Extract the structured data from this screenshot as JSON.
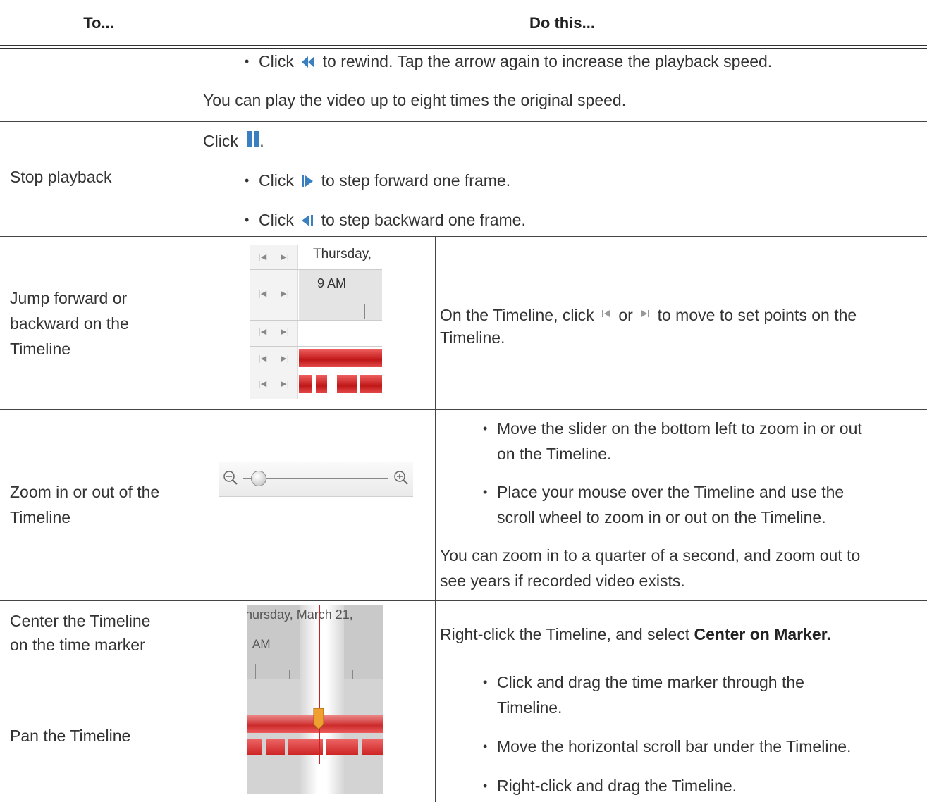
{
  "header": {
    "col1": "To...",
    "col2": "Do this..."
  },
  "rows": {
    "rewind": {
      "bullet": {
        "pre": "Click",
        "post": "to rewind. Tap the arrow again to increase the playback speed."
      },
      "note": "You can play the video up to eight times the original speed."
    },
    "stop": {
      "label": "Stop playback",
      "click": "Click",
      "period": ".",
      "bullets": [
        {
          "pre": "Click",
          "post": "to step forward one frame."
        },
        {
          "pre": "Click",
          "post": "to step backward one frame."
        }
      ]
    },
    "jump": {
      "label": [
        "Jump forward or",
        "backward on the",
        "Timeline"
      ],
      "image": {
        "day": "Thursday,",
        "time": "9 AM"
      },
      "text": {
        "pre": "On the Timeline, click",
        "mid": "or",
        "post": "to move to set points on the",
        "line2": "Timeline."
      }
    },
    "zoom": {
      "label": [
        "Zoom in or out of the",
        "Timeline"
      ],
      "bullets": [
        [
          "Move the slider on the bottom left to zoom in or out",
          "on the Timeline."
        ],
        [
          "Place your mouse over the Timeline and use the",
          "scroll wheel to zoom in or out on the Timeline."
        ]
      ],
      "note": [
        "You can zoom in to a quarter of a second, and zoom out to",
        "see years if recorded video exists."
      ]
    },
    "center": {
      "label": [
        "Center the Timeline",
        "on the time marker"
      ],
      "image": {
        "day": "hursday, March 21,",
        "time": "AM"
      },
      "text_pre": "Right-click the Timeline, and select",
      "text_bold": "Center on Marker."
    },
    "pan": {
      "label": "Pan the Timeline",
      "bullets": [
        [
          "Click and drag the time marker through the",
          "Timeline."
        ],
        [
          "Move the horizontal scroll bar under the Timeline."
        ],
        [
          "Right-click and drag the Timeline."
        ]
      ]
    }
  },
  "colors": {
    "icon_blue": "#3a7fbf",
    "timeline_red": "#d42a2a",
    "marker_orange": "#f0a030",
    "rule": "#444444"
  }
}
